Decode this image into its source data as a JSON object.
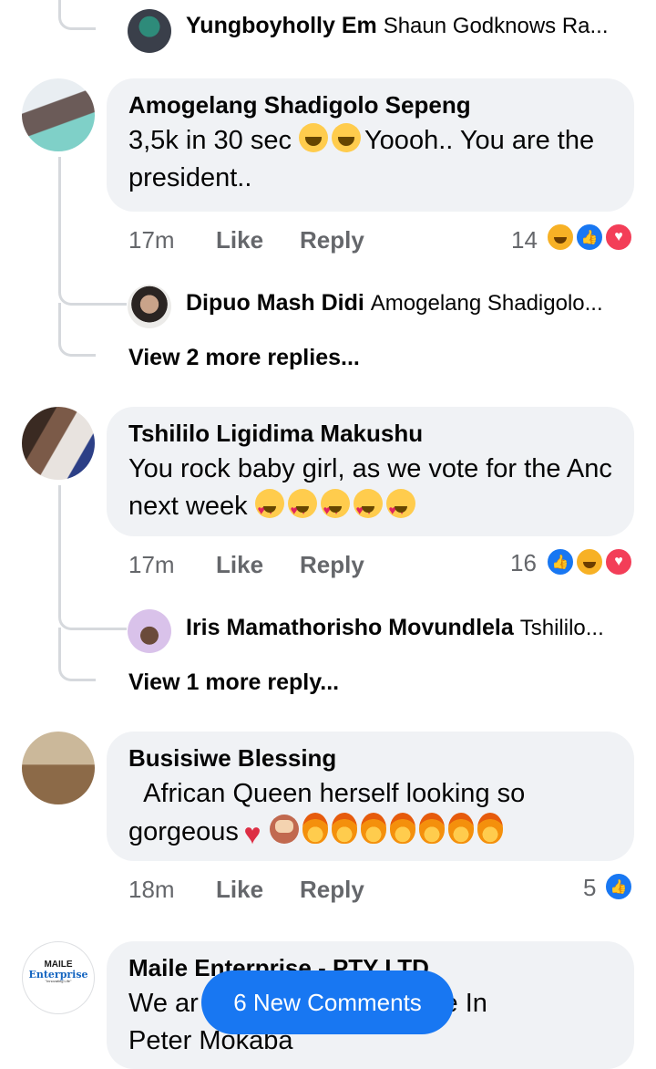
{
  "top_reply": {
    "author": "Yungboyholly Em",
    "snippet": "Shaun Godknows Ra..."
  },
  "comments": [
    {
      "author": "Amogelang Shadigolo Sepeng",
      "text_a": "3,5k in 30 sec ",
      "text_b": "Yoooh.. You are the president..",
      "time": "17m",
      "like": "Like",
      "reply": "Reply",
      "reaction_count": "14",
      "reactions": [
        "laugh-react-icon",
        "like-react-icon",
        "love-react-icon"
      ],
      "sub_reply": {
        "author": "Dipuo Mash Didi",
        "snippet": "Amogelang Shadigolo..."
      },
      "view_more": "View 2 more replies..."
    },
    {
      "author": "Tshililo Ligidima Makushu",
      "text_a": "You rock baby girl,  as we vote for the Anc next week ",
      "time": "17m",
      "like": "Like",
      "reply": "Reply",
      "reaction_count": "16",
      "reactions": [
        "like-react-icon",
        "laugh-react-icon",
        "love-react-icon"
      ],
      "sub_reply": {
        "author": "Iris Mamathorisho Movundlela",
        "snippet": "Tshililo..."
      },
      "view_more": "View 1 more reply..."
    },
    {
      "author": "Busisiwe Blessing",
      "text_a": "  African Queen herself looking so gorgeous",
      "time": "18m",
      "like": "Like",
      "reply": "Reply",
      "reaction_count": "5",
      "reactions": [
        "like-react-icon"
      ]
    },
    {
      "author": "Maile Enterprise - PTY LTD",
      "text_a": "We ar",
      "text_b": "Here In",
      "text_c": "Peter Mokaba",
      "avatar_logo_line1": "MAILE",
      "avatar_logo_line2": "Enterprise",
      "avatar_logo_line3": "\"Innovating Life\""
    }
  ],
  "new_comments_button": "6 New Comments",
  "colors": {
    "accent": "#1877f2",
    "love": "#f33e58",
    "laugh": "#f7b125",
    "bubble": "#f0f2f5",
    "meta_text": "#65676b",
    "thread_line": "#d6d9dd"
  }
}
